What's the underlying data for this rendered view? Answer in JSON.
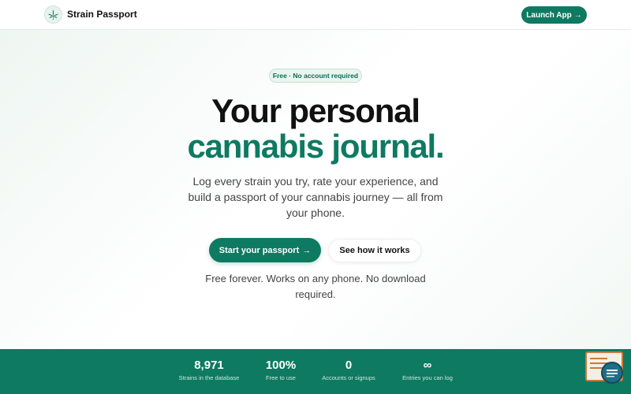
{
  "header": {
    "brand": "Strain Passport",
    "launch_label": "Launch App",
    "launch_arrow": "→"
  },
  "hero": {
    "badge": "Free · No account required",
    "title_line1": "Your personal",
    "title_line2": "cannabis journal.",
    "subtitle": "Log every strain you try, rate your experience, and build a passport of your cannabis journey — all from your phone.",
    "primary_button": "Start your passport",
    "primary_arrow": "→",
    "secondary_button": "See how it works",
    "note": "Free forever. Works on any phone. No download required."
  },
  "stats": [
    {
      "value": "8,971",
      "label": "Strains in the database"
    },
    {
      "value": "100%",
      "label": "Free to use"
    },
    {
      "value": "0",
      "label": "Accounts or signups"
    },
    {
      "value": "∞",
      "label": "Entries you can log"
    }
  ],
  "colors": {
    "accent": "#0e7a61",
    "text": "#111111",
    "muted": "#444444"
  },
  "icons": {
    "logo": "cannabis-leaf-icon",
    "widget": "feedback-widget-icon",
    "chat": "chat-bubble-icon"
  }
}
